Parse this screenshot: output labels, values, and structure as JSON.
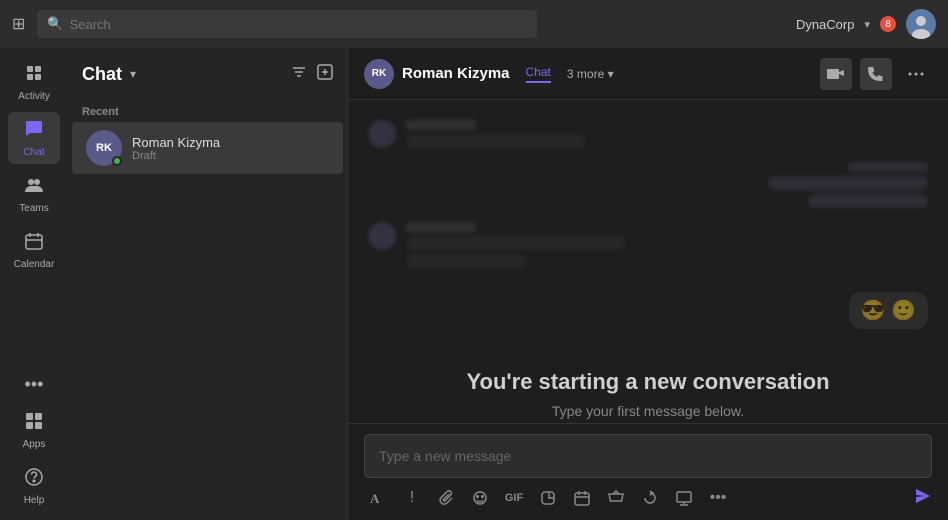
{
  "topbar": {
    "search_placeholder": "Search",
    "company": "DynaCorp",
    "notification_count": "8"
  },
  "sidebar": {
    "items": [
      {
        "label": "Activity",
        "icon": "🔔"
      },
      {
        "label": "Chat",
        "icon": "💬",
        "active": true
      },
      {
        "label": "Teams",
        "icon": "👥"
      },
      {
        "label": "Calendar",
        "icon": "📅"
      },
      {
        "label": "Apps",
        "icon": "⬛"
      },
      {
        "label": "Help",
        "icon": "❓"
      }
    ],
    "more": "..."
  },
  "chat_list": {
    "title": "Chat",
    "section": "Recent",
    "items": [
      {
        "initials": "RK",
        "name": "Roman Kizyma",
        "status": "Draft"
      }
    ]
  },
  "chat_header": {
    "initials": "RK",
    "name": "Roman Kizyma",
    "active_tab": "Chat",
    "more_tabs": "3 more"
  },
  "conversation": {
    "notice_title": "You're starting a new conversation",
    "notice_subtitle": "Type your first message below."
  },
  "message_input": {
    "placeholder": "Type a new message"
  },
  "toolbar": {
    "format": "A",
    "exclamation": "!",
    "attach": "📎",
    "emoji": "🙂",
    "giphy": "GIF",
    "sticker": "⬜",
    "meet": "📅",
    "delivery": "✉",
    "loop": "🔄",
    "whiteboard": "⬜",
    "more": "...",
    "send": "➤"
  }
}
